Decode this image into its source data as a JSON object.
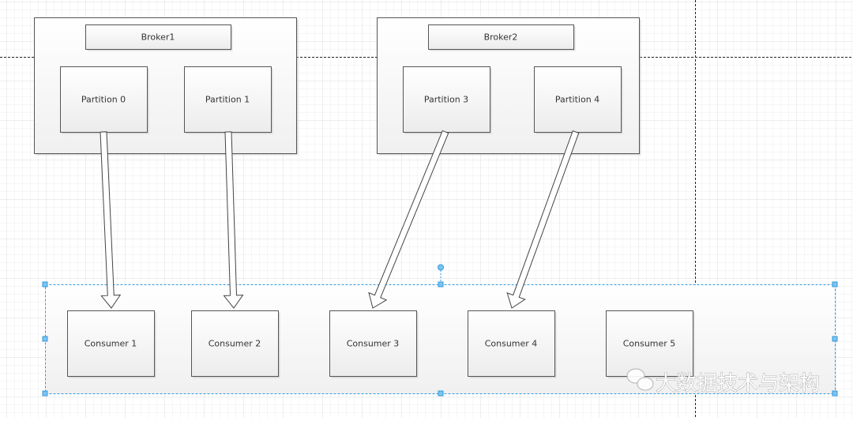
{
  "brokers": [
    {
      "label": "Broker1",
      "partitions": [
        "Partition 0",
        "Partition 1"
      ]
    },
    {
      "label": "Broker2",
      "partitions": [
        "Partition 3",
        "Partition 4"
      ]
    }
  ],
  "consumers": [
    "Consumer 1",
    "Consumer 2",
    "Consumer 3",
    "Consumer 4",
    "Consumer 5"
  ],
  "edges": [
    {
      "from": "Partition 0",
      "to": "Consumer 1"
    },
    {
      "from": "Partition 1",
      "to": "Consumer 2"
    },
    {
      "from": "Partition 3",
      "to": "Consumer 3"
    },
    {
      "from": "Partition 4",
      "to": "Consumer 4"
    }
  ],
  "watermark": {
    "text": "大数据技术与架构",
    "icon": "wechat-icon"
  },
  "colors": {
    "selection": "#3399dd",
    "handle": "#7cc4f0",
    "grid_minor": "#eceef0",
    "grid_major": "#d6d9dc"
  }
}
